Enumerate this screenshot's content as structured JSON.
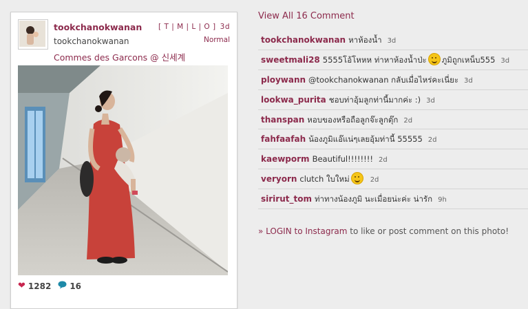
{
  "post": {
    "username": "tookchanokwanan",
    "full_name": "tookchanokwanan",
    "location": "Commes des Garcons @ 신세계",
    "sizes": "[ T | M | L | O ]",
    "time": "3d",
    "filter": "Normal",
    "likes": "1282",
    "comments_count": "16"
  },
  "comments_panel": {
    "view_all": "View All 16 Comment",
    "items": [
      {
        "user": "tookchanokwanan",
        "text": "หาห้องน้ำ",
        "time": "3d"
      },
      {
        "user": "sweetmali28",
        "text": "5555โอ้โหหห ท่าหาห้องน้ำป่ะ",
        "text2": "ภูมิถูกเหน็บ555",
        "time": "3d"
      },
      {
        "user": "ploywann",
        "text": "@tookchanokwanan กลับเมื่อไหร่คะเนี่ยะ",
        "time": "3d"
      },
      {
        "user": "lookwa_purita",
        "text": "ชอบท่าอุ้มลูกท่านี้มากค่ะ :)",
        "time": "3d"
      },
      {
        "user": "thanspan",
        "text": "หอบของหรือถือลูกจ๊ะลูกตุ๊ก",
        "time": "2d"
      },
      {
        "user": "fahfaafah",
        "text": "น้องภูมิแอ๊แน่ๆเลยอุ้มท่านี้ 55555",
        "time": "2d"
      },
      {
        "user": "kaewporm",
        "text": "Beautiful!!!!!!!!",
        "time": "2d"
      },
      {
        "user": "veryorn",
        "text": "clutch ใบใหม่",
        "time": "2d"
      },
      {
        "user": "sirirut_tom",
        "text": "ท่าทางน้องภูมิ นะเมื่อยน่ะค่ะ น่ารัก",
        "time": "9h"
      }
    ],
    "login_link": "LOGIN to Instagram",
    "login_rest": " to like or post comment on this photo!",
    "login_arrow": "»"
  }
}
